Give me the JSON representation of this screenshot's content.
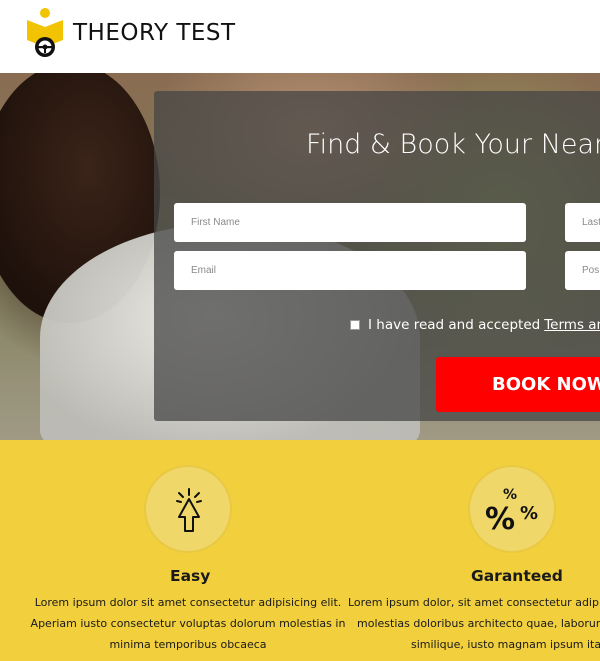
{
  "header": {
    "brand": "THEORY TEST",
    "brand_color": "#111111",
    "logo_icon": "book-steering-wheel-logo",
    "logo_color": "#f2c300"
  },
  "hero": {
    "title": "Find & Book Your Neare",
    "fields": {
      "first_name_placeholder": "First Name",
      "last_name_placeholder": "Last",
      "email_placeholder": "Email",
      "postcode_placeholder": "Pos"
    },
    "terms_text": "I have read and accepted",
    "terms_link": "Terms and",
    "book_button": "BOOK NOW!",
    "button_color": "#fe0000",
    "overlay_color": "#464646"
  },
  "features": [
    {
      "icon": "cursor-click-icon",
      "title": "Easy",
      "lines": [
        "Lorem ipsum dolor sit amet consectetur adipisicing elit.",
        "Aperiam iusto consectetur voluptas dolorum molestias in",
        "minima temporibus obcaeca"
      ]
    },
    {
      "icon": "percent-icon",
      "title": "Garanteed",
      "lines": [
        "Lorem ipsum dolor, sit amet consectetur adipisi",
        "molestias doloribus architecto quae, laborum r",
        "similique, iusto magnam ipsum itaq"
      ]
    }
  ],
  "features_bg": "#f1cf3d"
}
